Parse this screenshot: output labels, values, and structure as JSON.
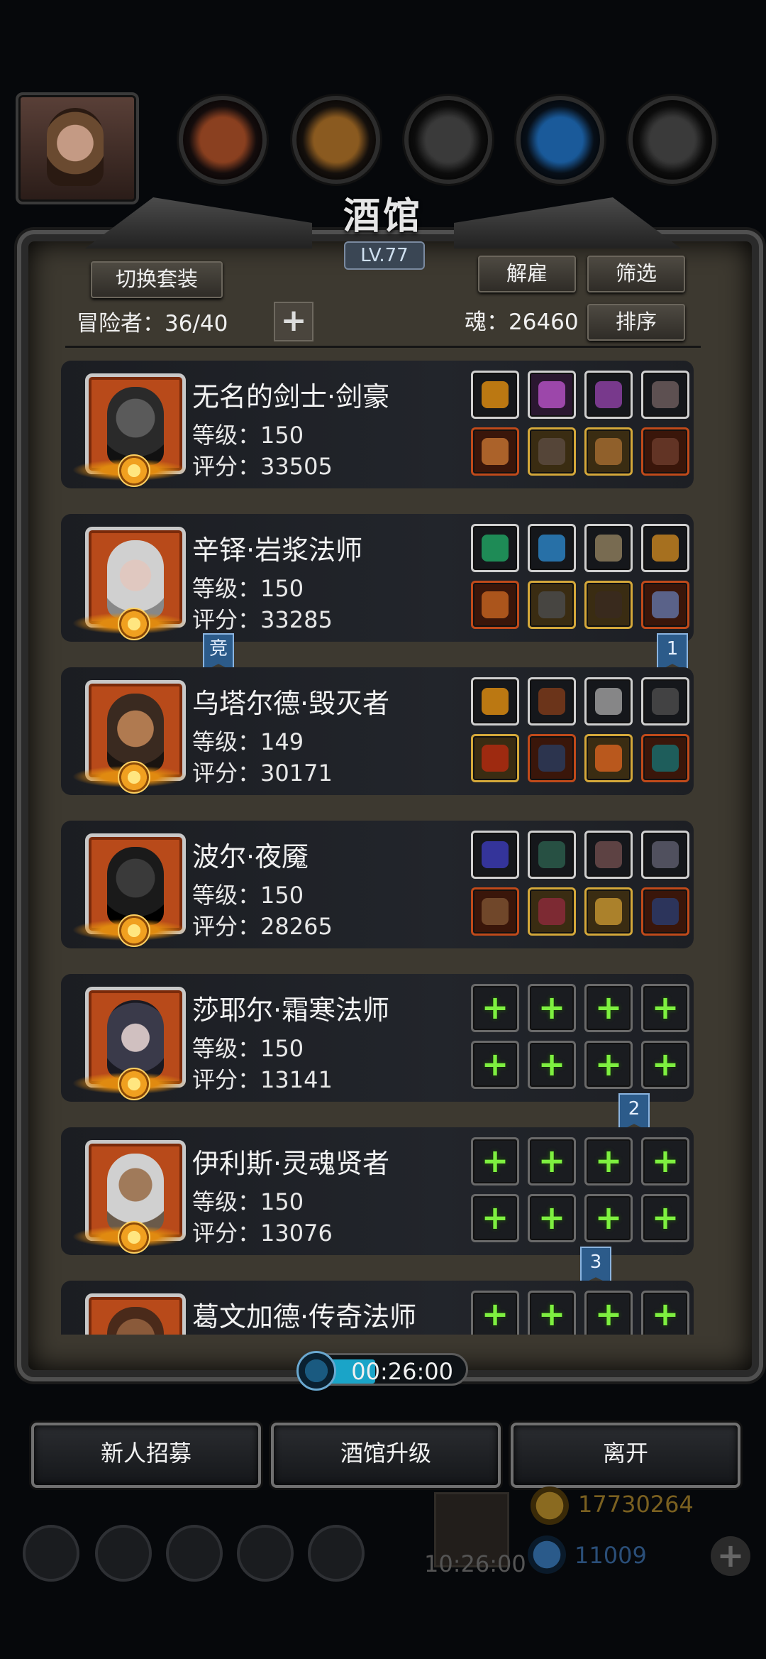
{
  "header": {
    "title": "酒馆",
    "level": "LV.77"
  },
  "controls": {
    "switch_outfit": "切换套装",
    "dismiss": "解雇",
    "filter": "筛选",
    "sort": "排序",
    "adventurers_label": "冒险者：36/40",
    "soul_label": "魂：26460"
  },
  "heroes": [
    {
      "name": "无名的剑士·剑豪",
      "level": "等级：150",
      "score": "评分：33505"
    },
    {
      "name": "辛铎·岩浆法师",
      "level": "等级：150",
      "score": "评分：33285"
    },
    {
      "name": "乌塔尔德·毁灭者",
      "level": "等级：149",
      "score": "评分：30171"
    },
    {
      "name": "波尔·夜魇",
      "level": "等级：150",
      "score": "评分：28265"
    },
    {
      "name": "莎耶尔·霜寒法师",
      "level": "等级：150",
      "score": "评分：13141"
    },
    {
      "name": "伊利斯·灵魂贤者",
      "level": "等级：150",
      "score": "评分：13076"
    },
    {
      "name": "葛文加德·传奇法师",
      "level": "",
      "score": ""
    }
  ],
  "flags": {
    "compete": "竞",
    "rank1": "1",
    "rank2": "2",
    "rank3": "3"
  },
  "timer": "00:26:00",
  "footer": {
    "recruit": "新人招募",
    "upgrade": "酒馆升级",
    "leave": "离开"
  },
  "hud": {
    "gold": "17730264",
    "gems": "11009",
    "gift_time": "10:26:00"
  }
}
